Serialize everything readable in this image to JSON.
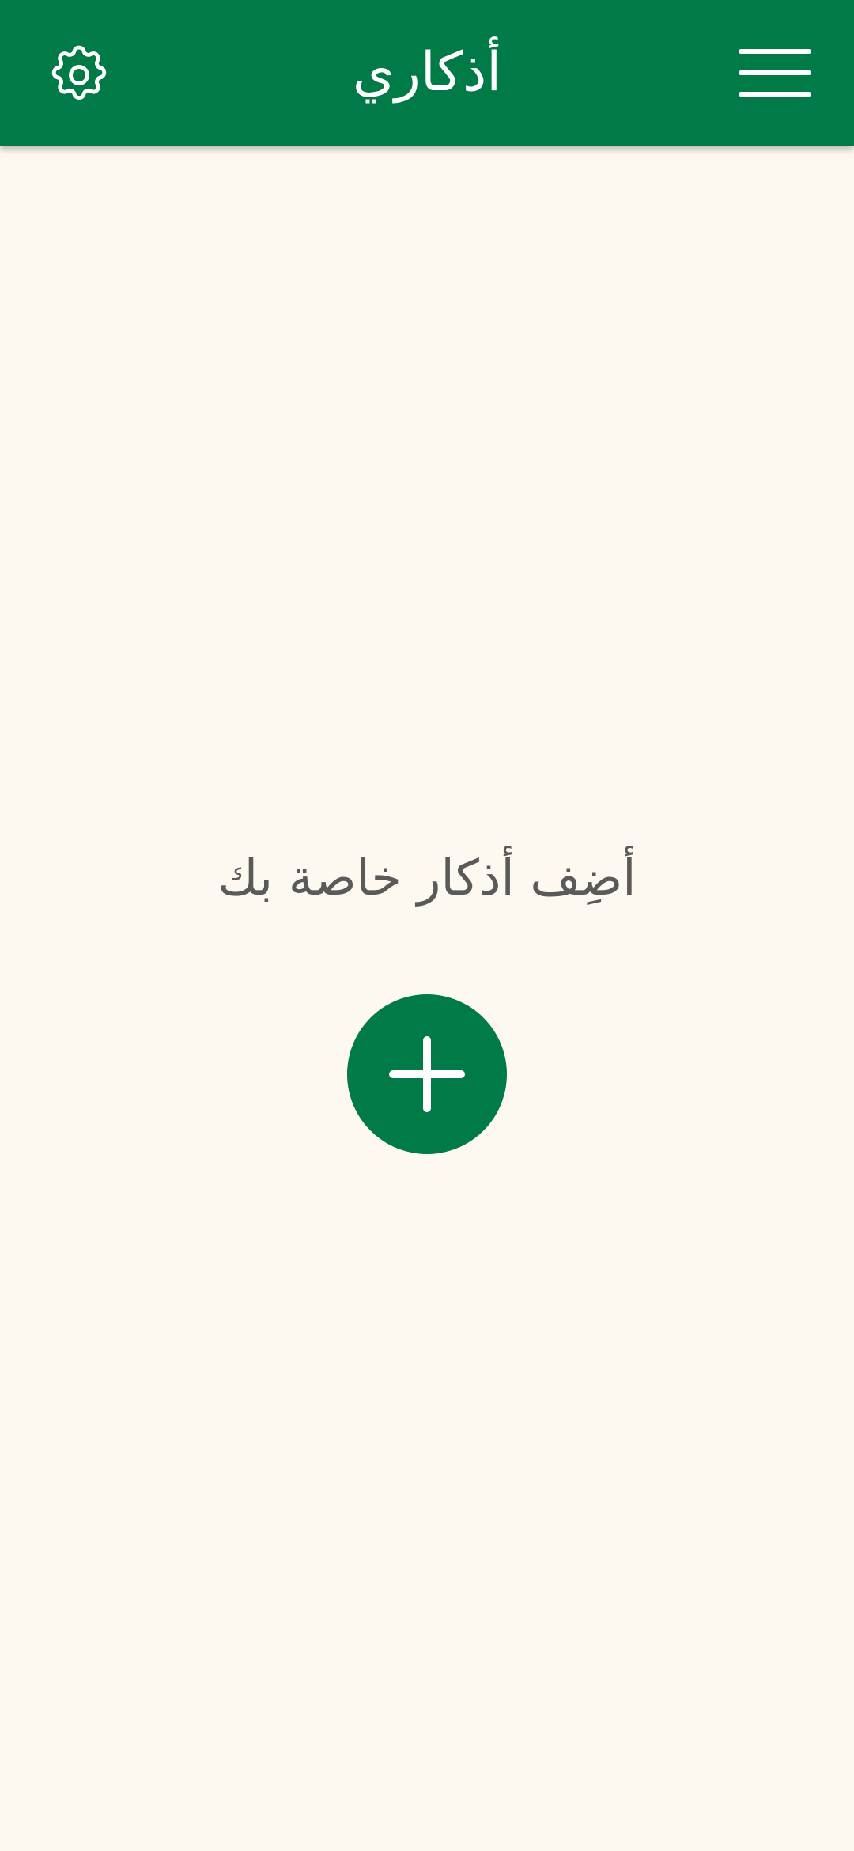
{
  "app_bar": {
    "title": "أذكاري",
    "settings_icon": "gear-icon",
    "menu_icon": "hamburger-menu-icon",
    "background_color": "#007a47"
  },
  "empty_state": {
    "message": "أضِف أذكار خاصة بك",
    "add_icon": "plus-icon",
    "button_color": "#007a47"
  },
  "colors": {
    "background": "#fdf9f0",
    "text_secondary": "#5a5a5a",
    "on_primary": "#ffffff"
  }
}
